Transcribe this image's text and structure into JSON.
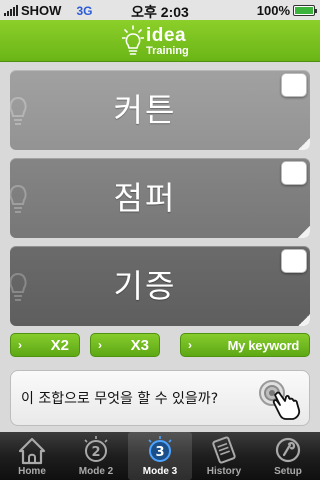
{
  "status_bar": {
    "carrier": "SHOW",
    "network": "3G",
    "time": "오후 2:03",
    "battery": "100%",
    "battery_level": 1.0
  },
  "header": {
    "logo_word": "idea",
    "logo_sub": "Training",
    "accent_color": "#76bd1d"
  },
  "cards": [
    {
      "word": "커튼",
      "icon": "lightbulb-icon"
    },
    {
      "word": "점퍼",
      "icon": "lightbulb-icon"
    },
    {
      "word": "기증",
      "icon": "lightbulb-icon"
    }
  ],
  "buttons": {
    "x2": "X2",
    "x3": "X3",
    "keyword": "My keyword",
    "chevron": "›"
  },
  "question": {
    "text": "이 조합으로 무엇을 할 수 있을까?",
    "icon": "tap-hand-icon"
  },
  "tabs": [
    {
      "label": "Home",
      "icon": "home-icon",
      "active": false
    },
    {
      "label": "Mode 2",
      "icon": "mode2-icon",
      "active": false
    },
    {
      "label": "Mode 3",
      "icon": "mode3-icon",
      "active": true
    },
    {
      "label": "History",
      "icon": "history-icon",
      "active": false
    },
    {
      "label": "Setup",
      "icon": "setup-icon",
      "active": false
    }
  ]
}
